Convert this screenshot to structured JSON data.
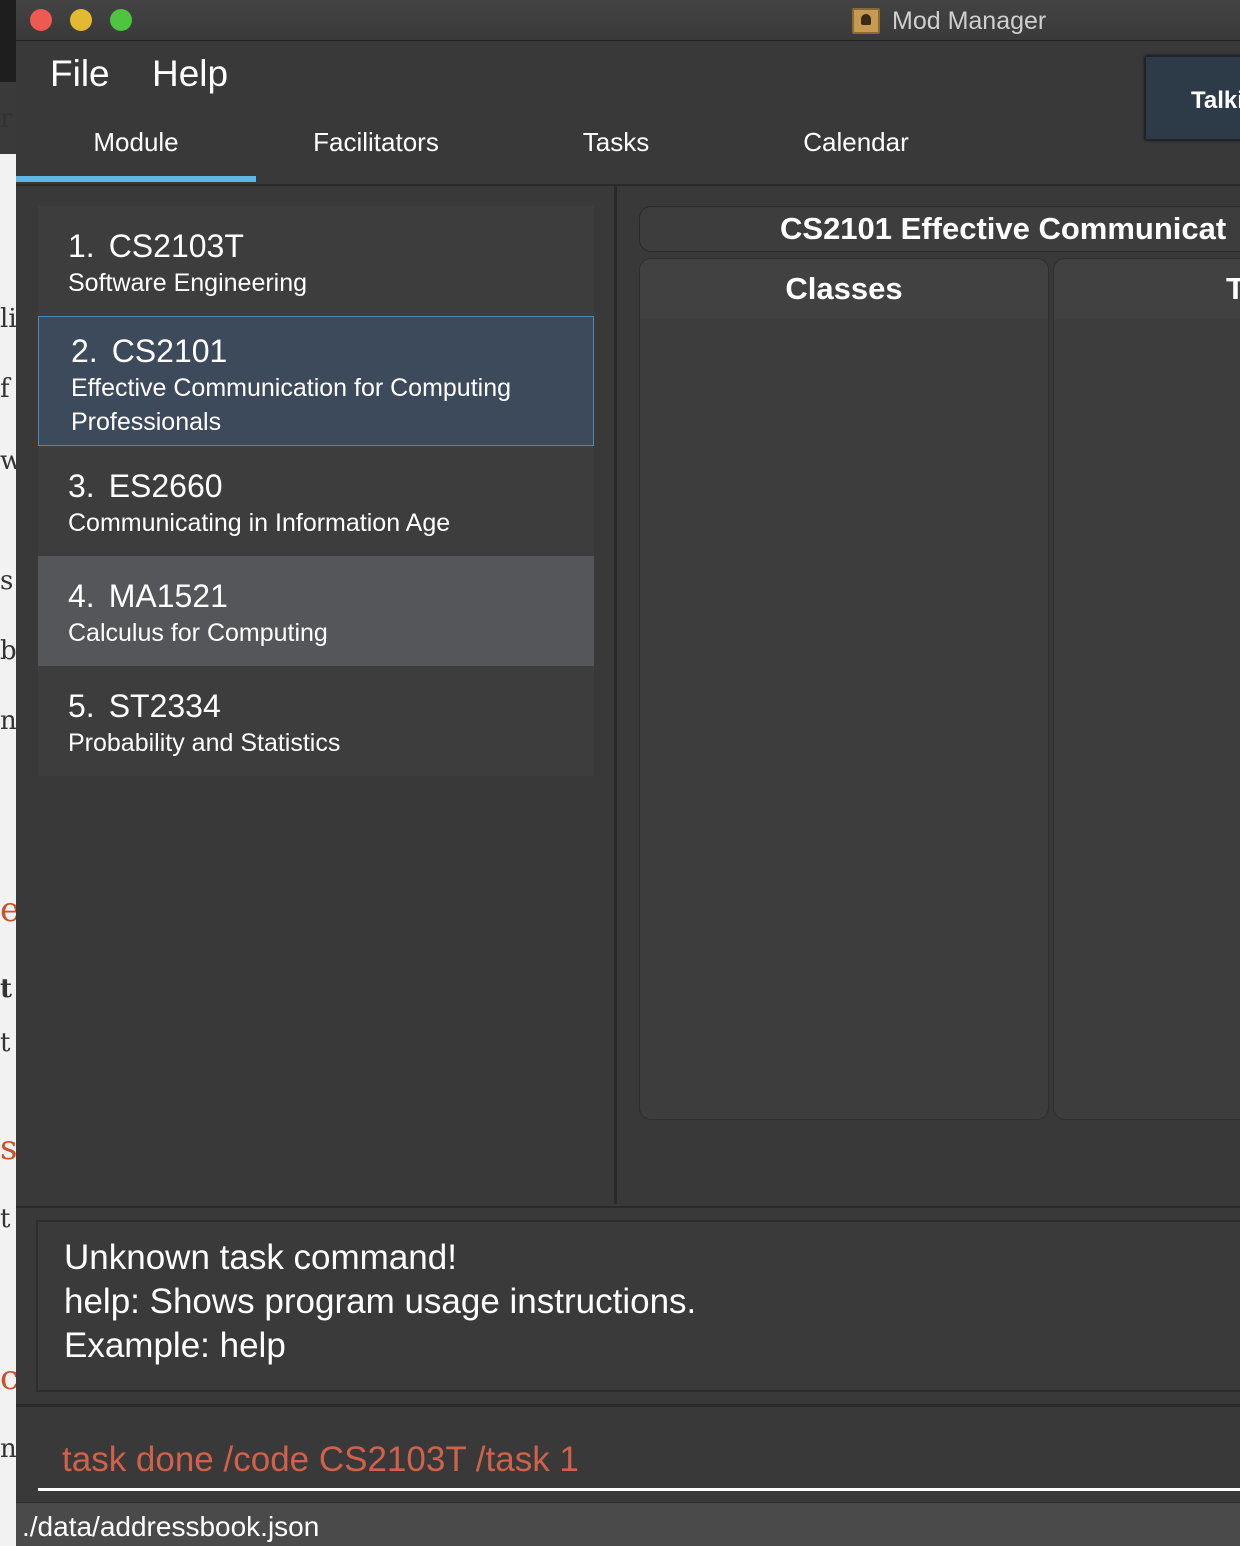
{
  "window": {
    "title": "Mod Manager"
  },
  "menu": {
    "file": "File",
    "help": "Help"
  },
  "popup_button": {
    "label": "Talki"
  },
  "tabs": [
    "Module",
    "Facilitators",
    "Tasks",
    "Calendar"
  ],
  "active_tab": "Module",
  "modules": [
    {
      "index": "1.",
      "code": "CS2103T",
      "name": "Software Engineering"
    },
    {
      "index": "2.",
      "code": "CS2101",
      "name": "Effective Communication for Computing Professionals"
    },
    {
      "index": "3.",
      "code": "ES2660",
      "name": "Communicating in Information Age"
    },
    {
      "index": "4.",
      "code": "MA1521",
      "name": "Calculus for Computing"
    },
    {
      "index": "5.",
      "code": "ST2334",
      "name": "Probability and Statistics"
    }
  ],
  "selected_module": "CS2101",
  "hovered_module": "MA1521",
  "detail": {
    "title": "CS2101 Effective Communicat",
    "classes_header": "Classes",
    "tasks_header": "T"
  },
  "result": {
    "lines": [
      "Unknown task command!",
      "help: Shows program usage instructions.",
      "Example: help"
    ]
  },
  "command": {
    "value": "task done /code CS2103T /task 1"
  },
  "status": {
    "path": "./data/addressbook.json"
  },
  "colors": {
    "accent": "#5ab8e8",
    "selected_bg": "#3d4a5c",
    "hover_bg": "#545659",
    "command_text": "#d0614a"
  }
}
